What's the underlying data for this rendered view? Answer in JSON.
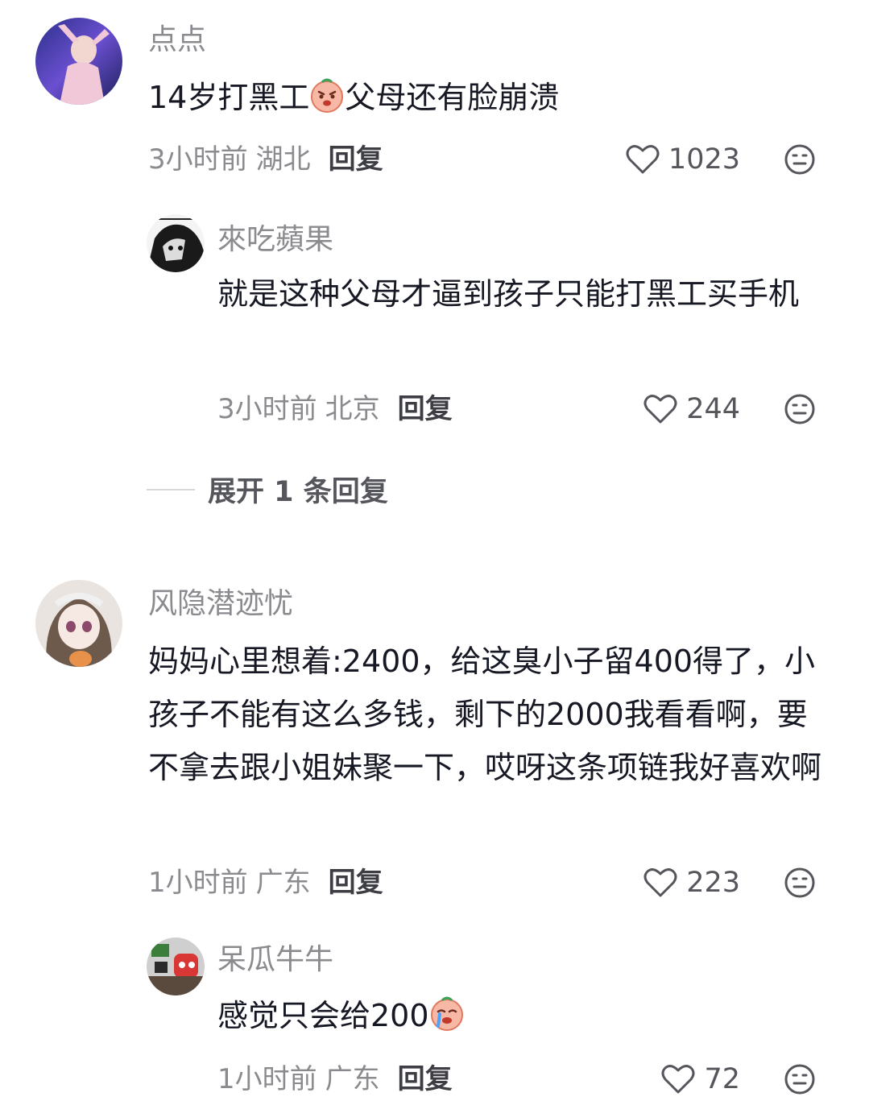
{
  "comments": [
    {
      "user": "点点",
      "text_before": "14岁打黑工",
      "emoji": "angry-face-emoji",
      "text_after": "父母还有脸崩溃",
      "time": "3小时前",
      "location": "湖北",
      "reply_label": "回复",
      "likes": "1023",
      "replies": [
        {
          "user": "來吃蘋果",
          "text": "就是这种父母才逼到孩子只能打黑工买手机",
          "time": "3小时前",
          "location": "北京",
          "reply_label": "回复",
          "likes": "244"
        }
      ],
      "expand_label": "展开 1 条回复"
    },
    {
      "user": "风隐潜迹忧",
      "text": "妈妈心里想着:2400，给这臭小子留400得了，小孩子不能有这么多钱，剩下的2000我看看啊，要不拿去跟小姐妹聚一下，哎呀这条项链我好喜欢啊",
      "time": "1小时前",
      "location": "广东",
      "reply_label": "回复",
      "likes": "223",
      "replies": [
        {
          "user": "呆瓜牛牛",
          "text_before": "感觉只会给200",
          "emoji": "crying-face-emoji",
          "time": "1小时前",
          "location": "广东",
          "reply_label": "回复",
          "likes": "72"
        }
      ]
    }
  ],
  "icons": {
    "like": "heart-outline-icon",
    "dislike": "meh-face-icon"
  },
  "colors": {
    "username": "#8a8a8f",
    "text": "#161823",
    "reply": "#3d3d44"
  }
}
